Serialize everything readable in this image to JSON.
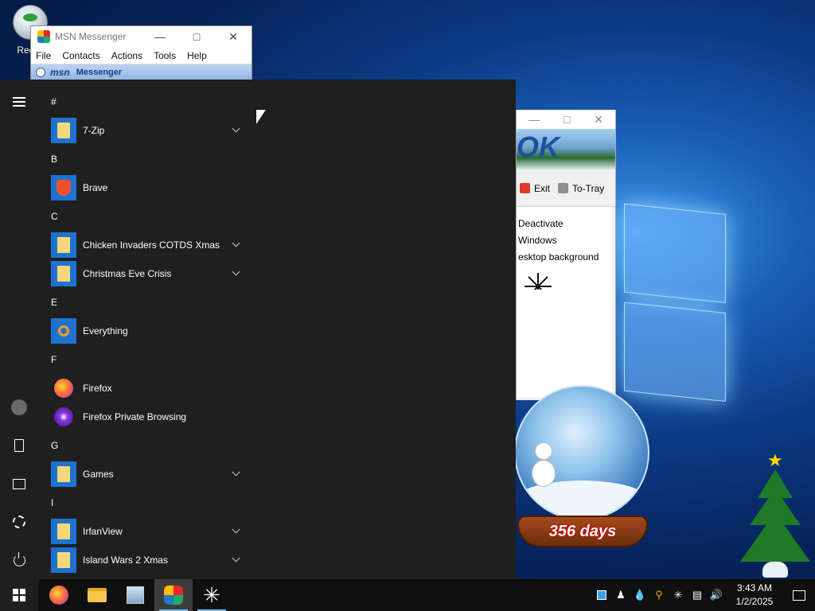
{
  "desktop": {
    "recycle_bin_label": "Recyc"
  },
  "msn_window": {
    "title": "MSN Messenger",
    "menu": [
      "File",
      "Contacts",
      "Actions",
      "Tools",
      "Help"
    ],
    "brand_logo": "msn",
    "brand_text": "Messenger"
  },
  "util_window": {
    "banner_text": "OK",
    "toolbar": [
      {
        "label": "Exit",
        "icon": "exit-icon",
        "color": "#e03a2a"
      },
      {
        "label": "To-Tray",
        "icon": "tray-icon",
        "color": "#8f8f8f"
      }
    ],
    "options": [
      "Deactivate",
      "Windows",
      "esktop background"
    ]
  },
  "snow_globe": {
    "days_text": "356 days"
  },
  "start_menu": {
    "groups": [
      {
        "letter": "#",
        "apps": [
          {
            "name": "7-Zip",
            "icon": "folder-icon",
            "expandable": true
          }
        ]
      },
      {
        "letter": "B",
        "apps": [
          {
            "name": "Brave",
            "icon": "brave-icon",
            "expandable": false
          }
        ]
      },
      {
        "letter": "C",
        "apps": [
          {
            "name": "Chicken Invaders COTDS Xmas",
            "icon": "folder-icon",
            "expandable": true
          },
          {
            "name": "Christmas Eve Crisis",
            "icon": "folder-icon",
            "expandable": true
          }
        ]
      },
      {
        "letter": "E",
        "apps": [
          {
            "name": "Everything",
            "icon": "everything-icon",
            "expandable": false
          }
        ]
      },
      {
        "letter": "F",
        "apps": [
          {
            "name": "Firefox",
            "icon": "firefox-icon",
            "expandable": false
          },
          {
            "name": "Firefox Private Browsing",
            "icon": "firefox-private-icon",
            "expandable": false
          }
        ]
      },
      {
        "letter": "G",
        "apps": [
          {
            "name": "Games",
            "icon": "folder-icon",
            "expandable": true
          }
        ]
      },
      {
        "letter": "I",
        "apps": [
          {
            "name": "IrfanView",
            "icon": "folder-icon",
            "expandable": true
          },
          {
            "name": "Island Wars 2 Xmas",
            "icon": "folder-icon",
            "expandable": true
          }
        ]
      }
    ]
  },
  "taskbar": {
    "pinned": [
      "windows-start-icon",
      "firefox-icon",
      "file-explorer-icon",
      "remote-desktop-icon",
      "msn-messenger-icon",
      "spark-app-icon"
    ],
    "clock": {
      "time": "3:43 AM",
      "date": "1/2/2025"
    }
  },
  "colors": {
    "start_bg": "#1f1f1f",
    "accent": "#1e73d0",
    "taskbar_bg": "#101010"
  }
}
